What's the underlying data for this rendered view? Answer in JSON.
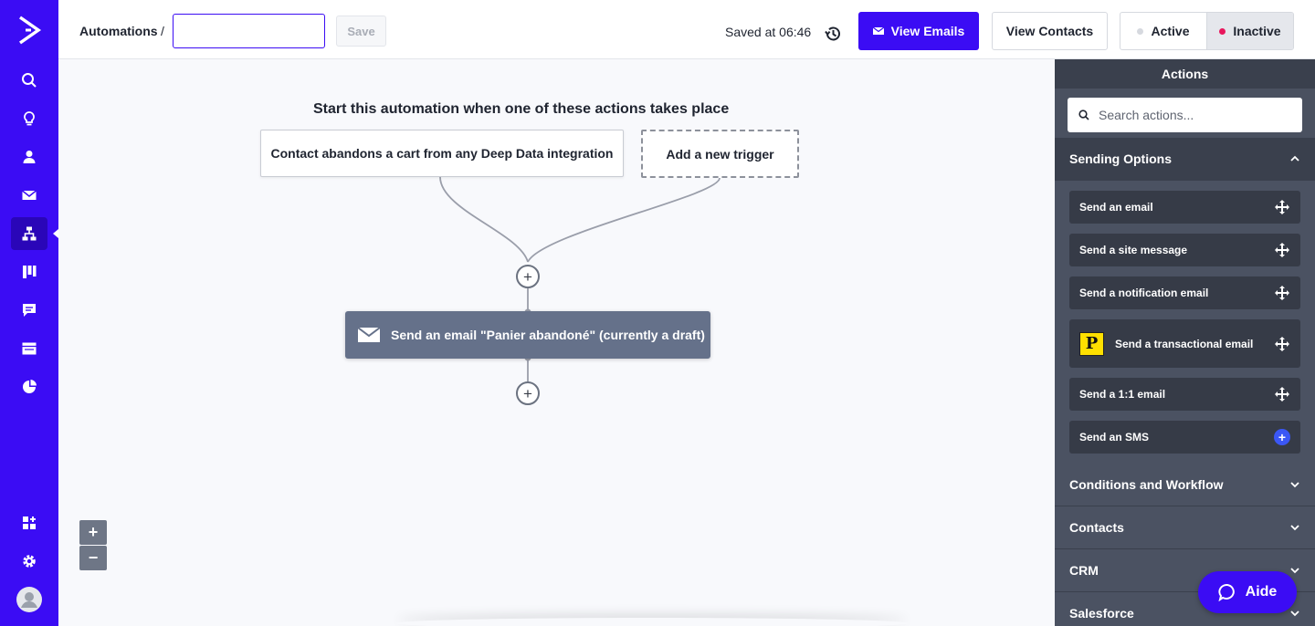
{
  "nav": {
    "items": [
      "search-icon",
      "lightbulb-icon",
      "contacts-icon",
      "campaigns-icon",
      "automations-icon",
      "deals-icon",
      "conversations-icon",
      "site-icon",
      "reports-icon",
      "apps-icon",
      "settings-icon",
      "profile-icon"
    ]
  },
  "header": {
    "breadcrumb": "Automations",
    "separator": "/",
    "name_value": "",
    "save_label": "Save",
    "saved_at": "Saved at 06:46",
    "view_emails": "View Emails",
    "view_contacts": "View Contacts",
    "active_label": "Active",
    "inactive_label": "Inactive",
    "status_selected": "Inactive",
    "colors": {
      "accent": "#3b0cf4",
      "active_dot": "#d6d9df",
      "inactive_dot": "#e8175d"
    }
  },
  "canvas": {
    "title": "Start this automation when one of these actions takes place",
    "trigger": "Contact abandons a cart from any Deep Data integration",
    "add_trigger": "Add a new trigger",
    "action": "Send an email \"Panier abandoné\" (currently a draft)",
    "zoom_in": "+",
    "zoom_out": "−"
  },
  "panel": {
    "title": "Actions",
    "search_placeholder": "Search actions...",
    "sections": [
      {
        "label": "Sending Options",
        "expanded": true
      },
      {
        "label": "Conditions and Workflow",
        "expanded": false
      },
      {
        "label": "Contacts",
        "expanded": false
      },
      {
        "label": "CRM",
        "expanded": false
      },
      {
        "label": "Salesforce",
        "expanded": false
      }
    ],
    "items": [
      {
        "label": "Send an email",
        "icon": "move-icon"
      },
      {
        "label": "Send a site message",
        "icon": "move-icon"
      },
      {
        "label": "Send a notification email",
        "icon": "move-icon"
      },
      {
        "label": "Send a transactional email",
        "icon": "move-icon",
        "badge": "P"
      },
      {
        "label": "Send a 1:1 email",
        "icon": "move-icon"
      },
      {
        "label": "Send an SMS",
        "icon": "plus-icon"
      }
    ]
  },
  "help": {
    "label": "Aide"
  }
}
